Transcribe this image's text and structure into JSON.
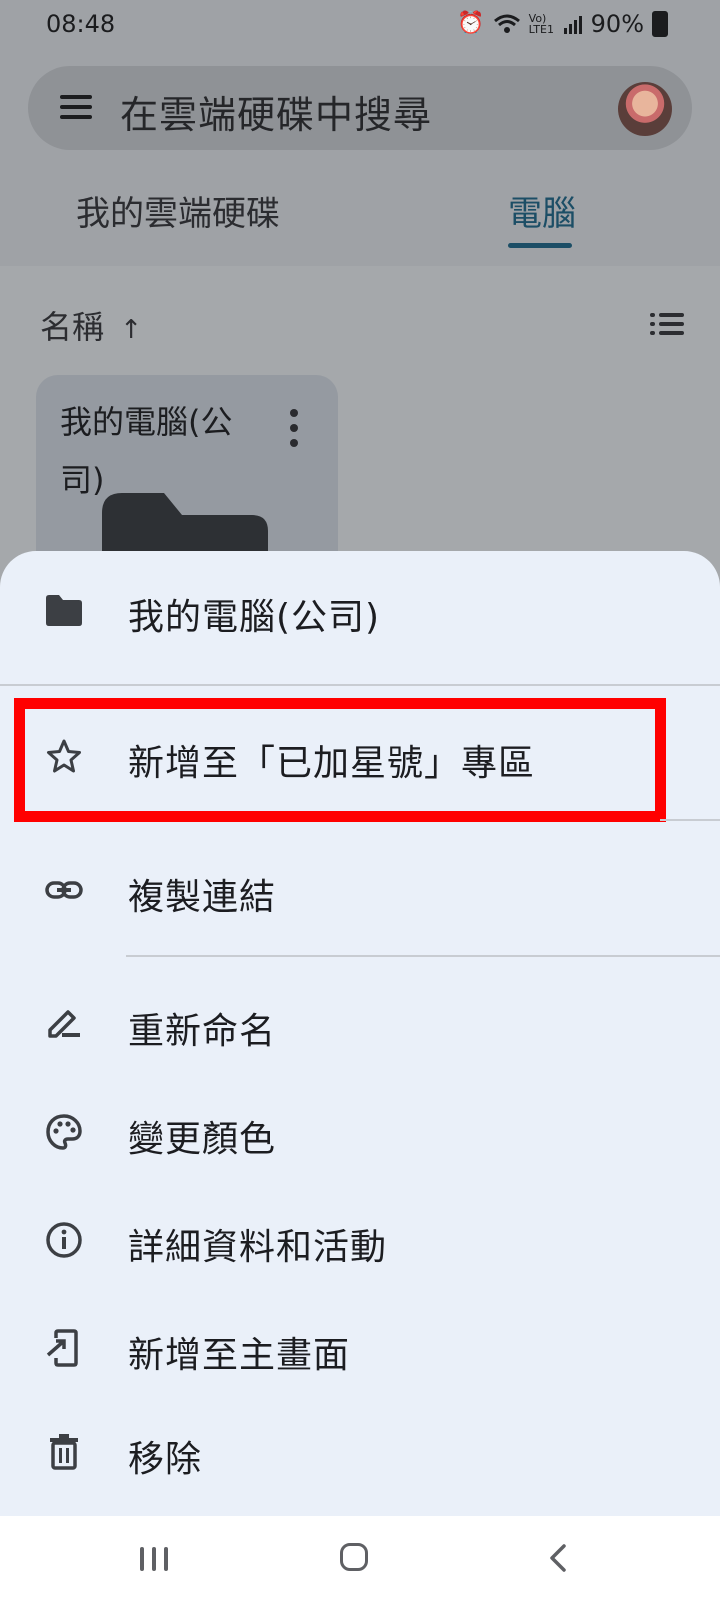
{
  "status_bar": {
    "time": "08:48",
    "icons": [
      "alarm-icon",
      "wifi-icon",
      "volte-icon",
      "signal-icon",
      "battery-icon"
    ],
    "network_label": "Vo) LTE1",
    "battery_percent": "90%"
  },
  "search": {
    "placeholder": "在雲端硬碟中搜尋"
  },
  "tabs": [
    {
      "label": "我的雲端硬碟",
      "selected": false
    },
    {
      "label": "電腦",
      "selected": true
    }
  ],
  "sort": {
    "label": "名稱",
    "direction_icon": "arrow-up-icon"
  },
  "folder_card": {
    "title": "我的電腦(公司)"
  },
  "sheet": {
    "header_title": "我的電腦(公司)",
    "items": [
      {
        "icon": "star-outline-icon",
        "label": "新增至「已加星號」專區"
      },
      {
        "icon": "link-icon",
        "label": "複製連結"
      },
      {
        "icon": "edit-icon",
        "label": "重新命名"
      },
      {
        "icon": "palette-icon",
        "label": "變更顏色"
      },
      {
        "icon": "info-icon",
        "label": "詳細資料和活動"
      },
      {
        "icon": "add-to-home-screen-icon",
        "label": "新增至主畫面"
      },
      {
        "icon": "trash-icon",
        "label": "移除"
      }
    ]
  },
  "colors": {
    "highlight": "#ff0000",
    "accent": "#1c4e66",
    "sheet_bg": "#eaf0f9"
  }
}
